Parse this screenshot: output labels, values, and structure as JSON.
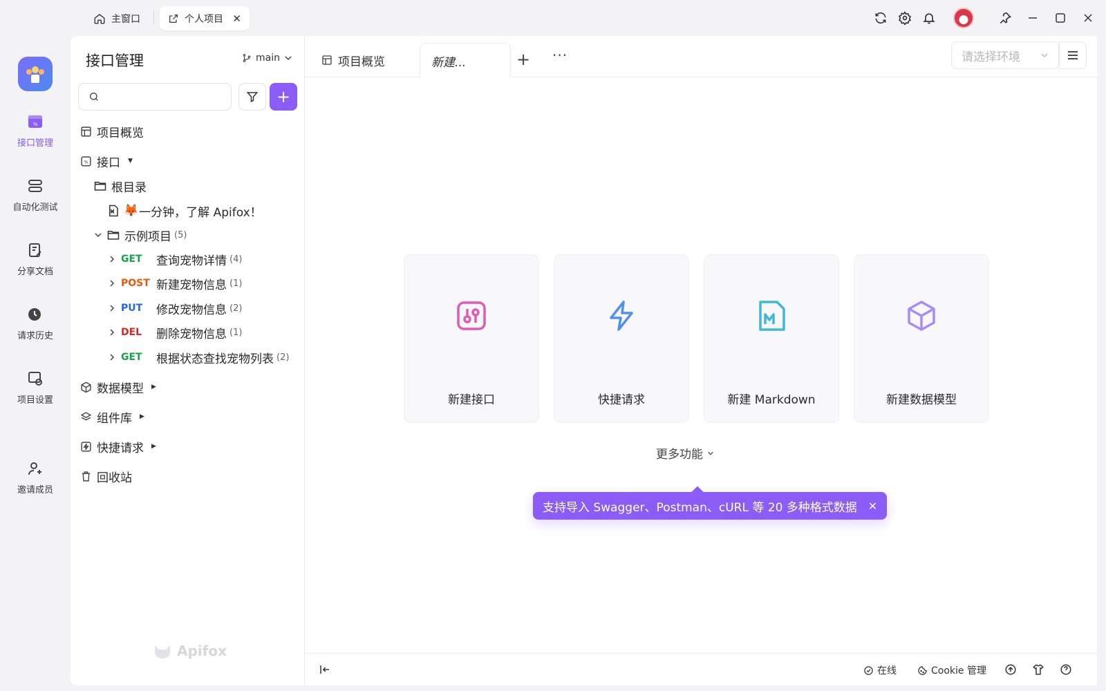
{
  "window": {
    "tabs": [
      {
        "label": "主窗口"
      },
      {
        "label": "个人项目"
      }
    ]
  },
  "rail": {
    "items": [
      {
        "label": "接口管理",
        "active": true
      },
      {
        "label": "自动化测试"
      },
      {
        "label": "分享文档"
      },
      {
        "label": "请求历史"
      },
      {
        "label": "项目设置"
      },
      {
        "label": "邀请成员"
      }
    ]
  },
  "sidebar": {
    "title": "接口管理",
    "branch": "main",
    "search_placeholder": "",
    "tree": {
      "overview": "项目概览",
      "api": "接口",
      "root": "根目录",
      "doc_emoji": "🦊",
      "doc": "一分钟，了解 Apifox！",
      "folder": "示例项目",
      "folder_count": "(5)",
      "endpoints": [
        {
          "method": "GET",
          "color": "#16a34a",
          "name": "查询宠物详情",
          "count": "(4)"
        },
        {
          "method": "POST",
          "color": "#ea580c",
          "name": "新建宠物信息",
          "count": "(1)"
        },
        {
          "method": "PUT",
          "color": "#2563eb",
          "name": "修改宠物信息",
          "count": "(2)"
        },
        {
          "method": "DEL",
          "color": "#dc2626",
          "name": "删除宠物信息",
          "count": "(1)"
        },
        {
          "method": "GET",
          "color": "#16a34a",
          "name": "根据状态查找宠物列表",
          "count": "(2)"
        }
      ],
      "models": "数据模型",
      "components": "组件库",
      "quick": "快捷请求",
      "trash": "回收站"
    },
    "watermark": "Apifox"
  },
  "main": {
    "tabs": {
      "overview": "项目概览",
      "new": "新建..."
    },
    "env_placeholder": "请选择环境",
    "cards": [
      {
        "label": "新建接口",
        "icon": "api-icon",
        "color": "#e05bb5"
      },
      {
        "label": "快捷请求",
        "icon": "lightning-icon",
        "color": "#4f8ff0"
      },
      {
        "label": "新建 Markdown",
        "icon": "markdown-icon",
        "color": "#3fb8d8"
      },
      {
        "label": "新建数据模型",
        "icon": "cube-icon",
        "color": "#a78bfa"
      }
    ],
    "more": "更多功能",
    "tooltip": "支持导入 Swagger、Postman、cURL 等 20 多种格式数据",
    "status": {
      "online": "在线",
      "cookie": "Cookie 管理"
    }
  },
  "colors": {
    "accent": "#8b5cf6"
  }
}
